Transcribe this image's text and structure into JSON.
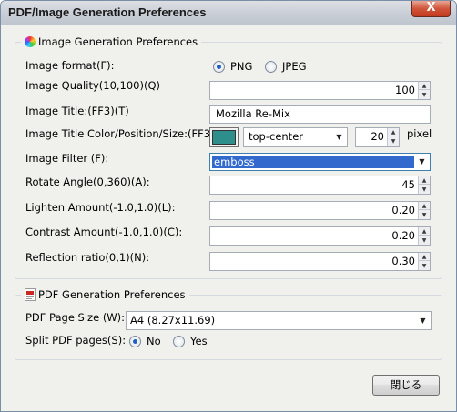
{
  "window": {
    "title": "PDF/Image Generation Preferences",
    "close_symbol": "X"
  },
  "image_group": {
    "legend": "Image Generation Preferences",
    "format": {
      "label": "Image format(F):",
      "options": [
        "PNG",
        "JPEG"
      ],
      "selected": "PNG"
    },
    "quality": {
      "label": "Image Quality(10,100)(Q)",
      "value": "100"
    },
    "title": {
      "label": "Image Title:(FF3)(T)",
      "value": "Mozilla Re-Mix"
    },
    "title_style": {
      "label": "Image Title Color/Position/Size:(FF3)",
      "color": "#2e8e8c",
      "position": "top-center",
      "size": "20",
      "unit": "pixel"
    },
    "filter": {
      "label": "Image Filter (F):",
      "value": "emboss"
    },
    "rotate": {
      "label": "Rotate Angle(0,360)(A):",
      "value": "45"
    },
    "lighten": {
      "label": "Lighten Amount(-1.0,1.0)(L):",
      "value": "0.20"
    },
    "contrast": {
      "label": "Contrast Amount(-1.0,1.0)(C):",
      "value": "0.20"
    },
    "reflection": {
      "label": "Reflection ratio(0,1)(N):",
      "value": "0.30"
    }
  },
  "pdf_group": {
    "legend": "PDF Generation Preferences",
    "page_size": {
      "label": "PDF Page Size (W):",
      "value": "A4 (8.27x11.69)"
    },
    "split": {
      "label": "Split PDF pages(S):",
      "options": [
        "No",
        "Yes"
      ],
      "selected": "No"
    }
  },
  "footer": {
    "close_label": "閉じる"
  },
  "colors": {
    "selection": "#3269cc",
    "title_color_swatch": "#2e8e8c",
    "close_button": "#c8472b"
  },
  "icons": {
    "image_group": "color-wheel-icon",
    "pdf_group": "pdf-document-icon"
  }
}
